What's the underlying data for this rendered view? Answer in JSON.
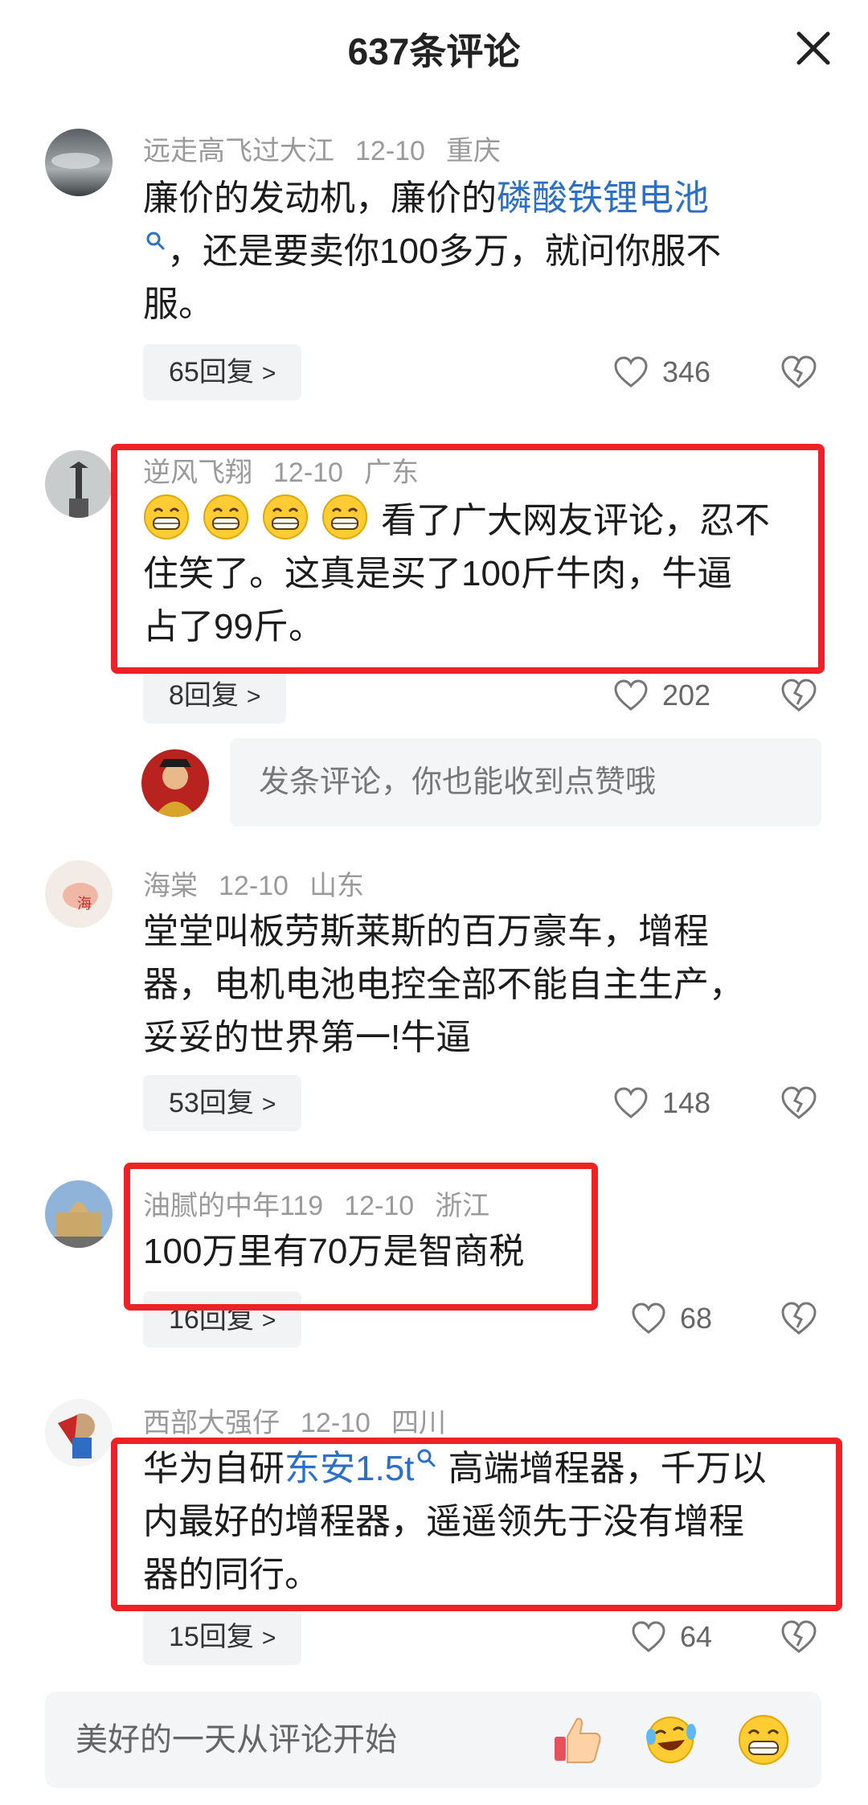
{
  "header": {
    "title": "637条评论"
  },
  "comments": [
    {
      "username": "远走高飞过大江",
      "date": "12-10",
      "location": "重庆",
      "text_line1_a": "廉价的发动机，廉价的",
      "text_link": "磷酸铁锂电池",
      "text_line2": "，还是要卖你100多万，就问你服不",
      "text_line3": "服。",
      "replies": "65回复",
      "likes": "346"
    },
    {
      "username": "逆风飞翔",
      "date": "12-10",
      "location": "广东",
      "text_line1": "看了广大网友评论，忍不",
      "text_line2": "住笑了。这真是买了100斤牛肉，牛逼",
      "text_line3": "占了99斤。",
      "replies": "8回复",
      "likes": "202"
    },
    {
      "username": "海棠",
      "date": "12-10",
      "location": "山东",
      "text_line1": "堂堂叫板劳斯莱斯的百万豪车，增程",
      "text_line2": "器，电机电池电控全部不能自主生产，",
      "text_line3": "妥妥的世界第一!牛逼",
      "replies": "53回复",
      "likes": "148"
    },
    {
      "username": "油腻的中年119",
      "date": "12-10",
      "location": "浙江",
      "text_line1": "100万里有70万是智商税",
      "replies": "16回复",
      "likes": "68"
    },
    {
      "username": "西部大强仔",
      "date": "12-10",
      "location": "四川",
      "text_line1_a": "华为自研",
      "text_link": "东安1.5t",
      "text_line1_b": " 高端增程器，千万以",
      "text_line2": "内最好的增程器，遥遥领先于没有增程",
      "text_line3": "器的同行。",
      "replies": "15回复",
      "likes": "64"
    }
  ],
  "reply_prompt": {
    "placeholder": "发条评论，你也能收到点赞哦"
  },
  "bottom_bar": {
    "placeholder": "美好的一天从评论开始"
  },
  "colors": {
    "highlight_box": "#ee2124",
    "link": "#2c6fc6",
    "meta": "#9a9a9a"
  }
}
